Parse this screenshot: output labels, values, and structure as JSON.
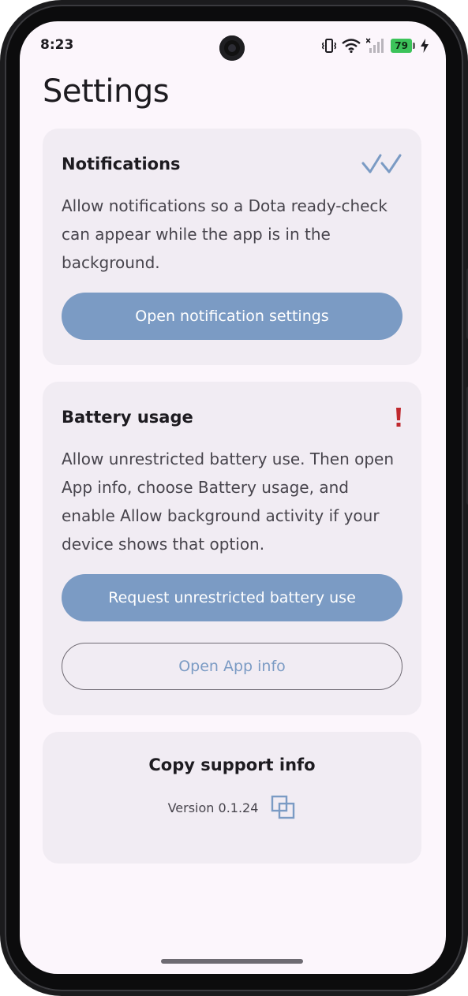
{
  "status_bar": {
    "time": "8:23",
    "battery_level": "79",
    "icons": [
      "vibrate-icon",
      "wifi-icon",
      "no-signal-icon",
      "battery-icon",
      "charging-icon"
    ]
  },
  "page": {
    "title": "Settings"
  },
  "notifications_card": {
    "title": "Notifications",
    "status_icon": "double-check-icon",
    "description": "Allow notifications so a Dota ready-check can appear while the app is in the background.",
    "button_label": "Open notification settings"
  },
  "battery_card": {
    "title": "Battery usage",
    "status_icon": "exclamation-icon",
    "description": "Allow unrestricted battery use. Then open App info, choose Battery usage, and enable Allow background activity if your device shows that option.",
    "primary_button_label": "Request unrestricted battery use",
    "secondary_button_label": "Open App info"
  },
  "support_card": {
    "title": "Copy support info",
    "version": "Version 0.1.24",
    "copy_icon": "copy-icon"
  },
  "colors": {
    "accent": "#7b9bc4",
    "background": "#fcf6fc",
    "card": "#f1ecf3",
    "warning": "#c0282d"
  }
}
